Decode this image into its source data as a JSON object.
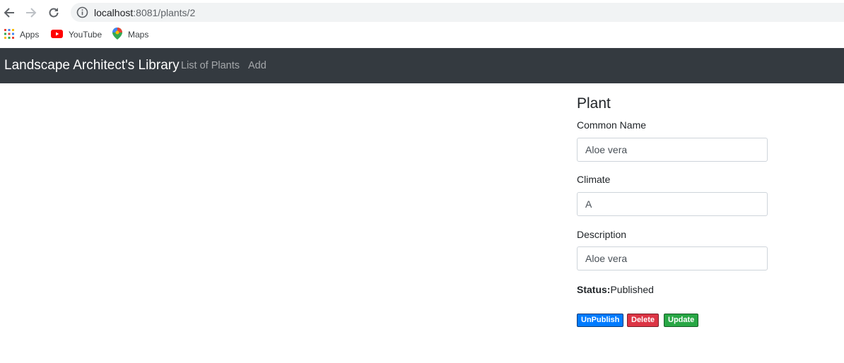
{
  "browser": {
    "url_host": "localhost",
    "url_port_path": ":8081/plants/2",
    "bookmarks": [
      {
        "label": "Apps",
        "icon": "apps-grid-icon"
      },
      {
        "label": "YouTube",
        "icon": "youtube-icon"
      },
      {
        "label": "Maps",
        "icon": "maps-pin-icon"
      }
    ]
  },
  "navbar": {
    "brand": "Landscape Architect's Library",
    "links": [
      "List of Plants",
      "Add"
    ]
  },
  "form": {
    "title": "Plant",
    "common_name": {
      "label": "Common Name",
      "value": "Aloe vera"
    },
    "climate": {
      "label": "Climate",
      "value": "A"
    },
    "description": {
      "label": "Description",
      "value": "Aloe vera"
    },
    "status_label": "Status:",
    "status_value": "Published",
    "buttons": {
      "unpublish": "UnPublish",
      "delete": "Delete",
      "update": "Update"
    }
  },
  "colors": {
    "navbar_bg": "#343a40",
    "primary": "#007bff",
    "danger": "#dc3545",
    "success": "#28a745"
  }
}
